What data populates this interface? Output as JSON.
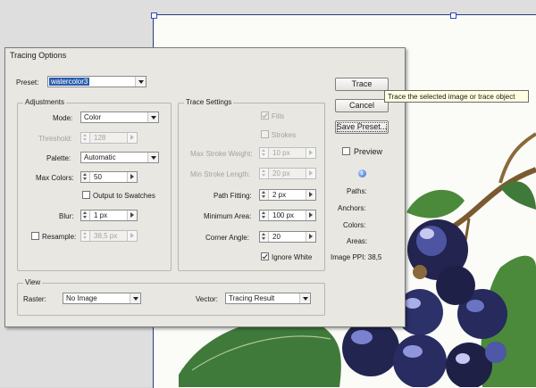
{
  "dialog": {
    "title": "Tracing Options",
    "preset_label": "Preset:",
    "preset_value": "watercolor3"
  },
  "adjustments": {
    "title": "Adjustments",
    "mode_label": "Mode:",
    "mode_value": "Color",
    "threshold_label": "Threshold:",
    "threshold_value": "128",
    "palette_label": "Palette:",
    "palette_value": "Automatic",
    "max_colors_label": "Max Colors:",
    "max_colors_value": "50",
    "output_swatches_label": "Output to Swatches",
    "output_swatches_checked": false,
    "blur_label": "Blur:",
    "blur_value": "1 px",
    "resample_label": "Resample:",
    "resample_checked": false,
    "resample_value": "38,5 px"
  },
  "trace_settings": {
    "title": "Trace Settings",
    "fills_label": "Fills",
    "fills_checked": true,
    "strokes_label": "Strokes",
    "strokes_checked": false,
    "max_stroke_weight_label": "Max Stroke Weight:",
    "max_stroke_weight_value": "10 px",
    "min_stroke_length_label": "Min Stroke Length:",
    "min_stroke_length_value": "20 px",
    "path_fitting_label": "Path Fitting:",
    "path_fitting_value": "2 px",
    "minimum_area_label": "Minimum Area:",
    "minimum_area_value": "100 px",
    "corner_angle_label": "Corner Angle:",
    "corner_angle_value": "20",
    "ignore_white_label": "Ignore White",
    "ignore_white_checked": true
  },
  "view": {
    "title": "View",
    "raster_label": "Raster:",
    "raster_value": "No Image",
    "vector_label": "Vector:",
    "vector_value": "Tracing Result"
  },
  "buttons": {
    "trace": "Trace",
    "cancel": "Cancel",
    "save_preset": "Save Preset..."
  },
  "preview": {
    "label": "Preview",
    "checked": false
  },
  "info": {
    "icon": "info-icon",
    "paths_label": "Paths:",
    "anchors_label": "Anchors:",
    "colors_label": "Colors:",
    "areas_label": "Areas:",
    "image_ppi_label": "Image PPI: 38,5"
  },
  "tooltip": {
    "text": "Trace the selected image or trace object"
  },
  "colors": {
    "dialog_bg": "#e9e7e2",
    "selection_blue": "#2a5db0",
    "tooltip_bg": "#ffffe1",
    "berry_dark": "#1f2048",
    "berry_mid": "#4a4f96",
    "leaf_green": "#3f7a3a"
  }
}
